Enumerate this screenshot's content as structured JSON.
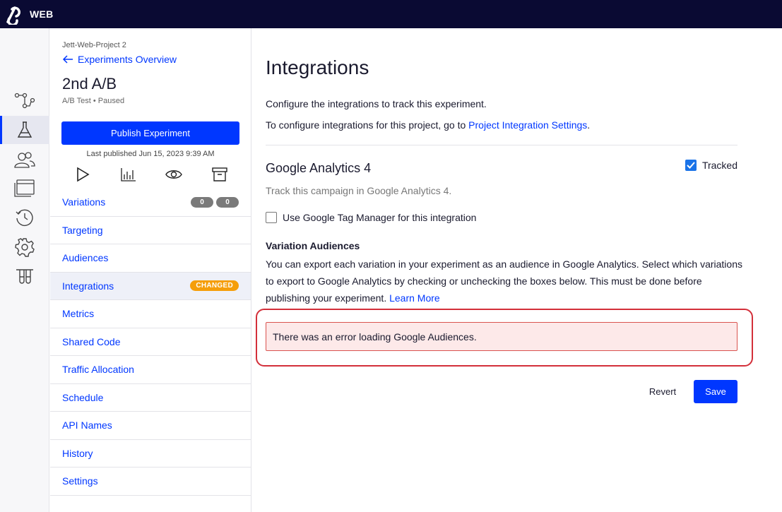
{
  "topbar": {
    "brand": "WEB",
    "logo_icon": "optimizely-logo-icon"
  },
  "rail": {
    "items": [
      {
        "icon": "flow-icon",
        "active": false
      },
      {
        "icon": "flask-icon",
        "active": true
      },
      {
        "icon": "users-icon",
        "active": false
      },
      {
        "icon": "browser-icon",
        "active": false
      },
      {
        "icon": "history-icon",
        "active": false
      },
      {
        "icon": "gear-icon",
        "active": false
      },
      {
        "icon": "test-tubes-icon",
        "active": false
      }
    ]
  },
  "panel": {
    "project": "Jett-Web-Project 2",
    "back_label": "Experiments Overview",
    "title": "2nd A/B",
    "type": "A/B Test",
    "status": "Paused",
    "publish_label": "Publish Experiment",
    "last_published": "Last published Jun 15, 2023 9:39 AM",
    "nav": [
      {
        "label": "Variations",
        "badges": [
          "0",
          "0"
        ]
      },
      {
        "label": "Targeting"
      },
      {
        "label": "Audiences"
      },
      {
        "label": "Integrations",
        "tag": "CHANGED",
        "active": true
      },
      {
        "label": "Metrics"
      },
      {
        "label": "Shared Code"
      },
      {
        "label": "Traffic Allocation"
      },
      {
        "label": "Schedule"
      },
      {
        "label": "API Names"
      },
      {
        "label": "History"
      },
      {
        "label": "Settings"
      }
    ]
  },
  "main": {
    "title": "Integrations",
    "intro": "Configure the integrations to track this experiment.",
    "project_prefix": "To configure integrations for this project, go to ",
    "project_link": "Project Integration Settings",
    "project_suffix": ".",
    "ga": {
      "title": "Google Analytics 4",
      "tracked_label": "Tracked",
      "subtitle": "Track this campaign in Google Analytics 4.",
      "gtm_label": "Use Google Tag Manager for this integration"
    },
    "audiences": {
      "title": "Variation Audiences",
      "text": "You can export each variation in your experiment as an audience in Google Analytics. Select which variations to export to Google Analytics by checking or unchecking the boxes below. This must be done before publishing your experiment. ",
      "learn_more": "Learn More"
    },
    "error": "There was an error loading Google Audiences.",
    "revert_label": "Revert",
    "save_label": "Save"
  },
  "colors": {
    "accent": "#0037ff",
    "topbar": "#0a0a33",
    "changed": "#f59e0b",
    "error_border": "#d9534f",
    "highlight": "#d32f3a"
  }
}
